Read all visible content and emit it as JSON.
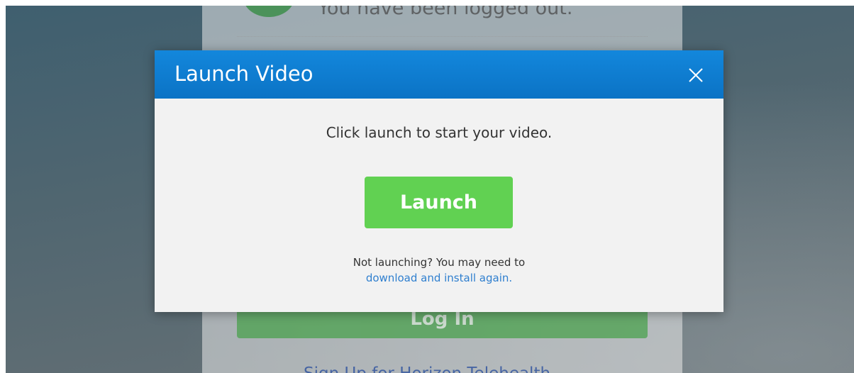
{
  "background_page": {
    "logout_message": "You have been logged out.",
    "login_button_label": "Log In",
    "signup_link": "Sign Up for Horizon Telehealth"
  },
  "modal": {
    "title": "Launch Video",
    "close_icon": "close-icon",
    "prompt": "Click launch to start your video.",
    "launch_button_label": "Launch",
    "help_text": "Not launching? You may need to",
    "download_link_text": "download and install again."
  },
  "colors": {
    "header_blue": "#0b73c5",
    "launch_green": "#61d152",
    "link_blue": "#2f7fcf",
    "login_green": "#43a046"
  }
}
